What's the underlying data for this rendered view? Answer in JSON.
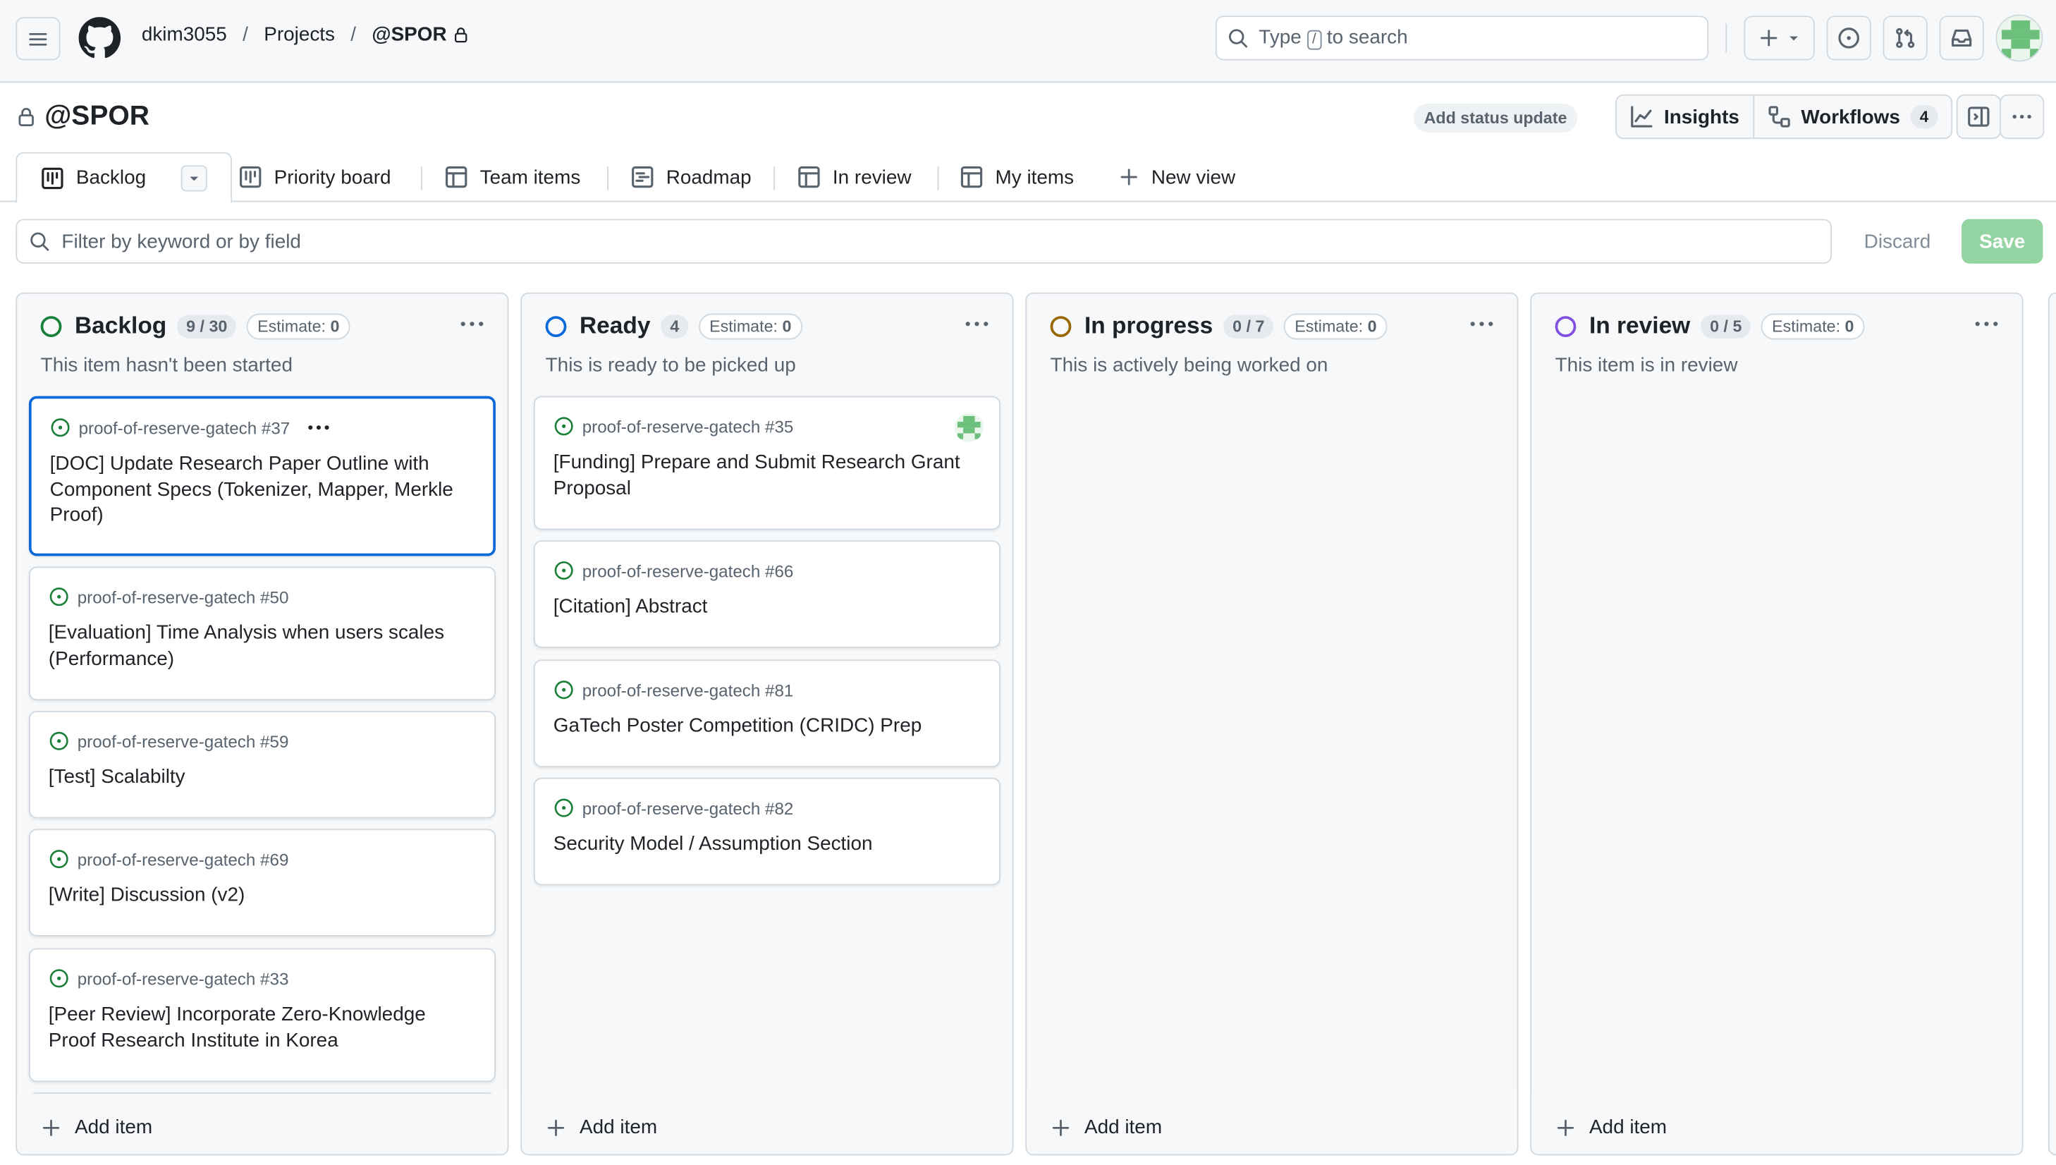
{
  "header": {
    "breadcrumb": [
      "dkim3055",
      "Projects",
      "@SPOR"
    ],
    "search_prefix": "Type",
    "search_key": "/",
    "search_suffix": "to search"
  },
  "project": {
    "title": "@SPOR",
    "status_update": "Add status update",
    "insights": "Insights",
    "workflows": "Workflows",
    "workflows_count": "4"
  },
  "tabs": [
    "Backlog",
    "Priority board",
    "Team items",
    "Roadmap",
    "In review",
    "My items",
    "New view"
  ],
  "filter": {
    "placeholder": "Filter by keyword or by field",
    "discard": "Discard",
    "save": "Save"
  },
  "columns": [
    {
      "title": "Backlog",
      "count": "9 / 30",
      "estimate_label": "Estimate:",
      "estimate": "0",
      "desc": "This item hasn't been started",
      "color": "#1a7f37",
      "cards": [
        {
          "ref": "proof-of-reserve-gatech #37",
          "title": "[DOC] Update Research Paper Outline with Component Specs (Tokenizer, Mapper, Merkle Proof)"
        },
        {
          "ref": "proof-of-reserve-gatech #50",
          "title": "[Evaluation] Time Analysis when users scales (Performance)"
        },
        {
          "ref": "proof-of-reserve-gatech #59",
          "title": "[Test] Scalabilty"
        },
        {
          "ref": "proof-of-reserve-gatech #69",
          "title": "[Write] Discussion (v2)"
        },
        {
          "ref": "proof-of-reserve-gatech #33",
          "title": "[Peer Review] Incorporate Zero-Knowledge Proof Research Institute in Korea"
        }
      ],
      "add": "Add item"
    },
    {
      "title": "Ready",
      "count": "4",
      "estimate_label": "Estimate:",
      "estimate": "0",
      "desc": "This is ready to be picked up",
      "color": "#0969da",
      "cards": [
        {
          "ref": "proof-of-reserve-gatech #35",
          "title": "[Funding] Prepare and Submit Research Grant Proposal"
        },
        {
          "ref": "proof-of-reserve-gatech #66",
          "title": "[Citation] Abstract"
        },
        {
          "ref": "proof-of-reserve-gatech #81",
          "title": "GaTech Poster Competition (CRIDC) Prep"
        },
        {
          "ref": "proof-of-reserve-gatech #82",
          "title": "Security Model / Assumption Section"
        }
      ],
      "add": "Add item"
    },
    {
      "title": "In progress",
      "count": "0 / 7",
      "estimate_label": "Estimate:",
      "estimate": "0",
      "desc": "This is actively being worked on",
      "color": "#9a6700",
      "cards": [],
      "add": "Add item"
    },
    {
      "title": "In review",
      "count": "0 / 5",
      "estimate_label": "Estimate:",
      "estimate": "0",
      "desc": "This item is in review",
      "color": "#8250df",
      "cards": [],
      "add": "Add item"
    }
  ]
}
